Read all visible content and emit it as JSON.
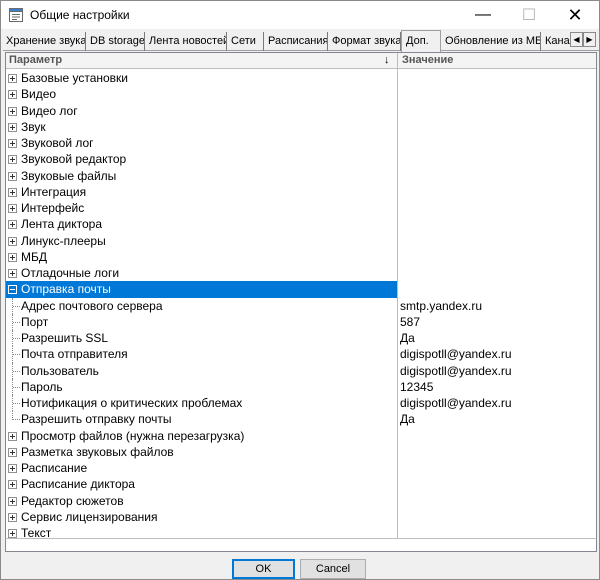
{
  "window": {
    "title": "Общие настройки",
    "icon": "settings-window-icon",
    "minimize_glyph": "—",
    "maximize_glyph": "☐",
    "close_glyph": "✕"
  },
  "tabs": [
    {
      "label": "Хранение звука",
      "active": false
    },
    {
      "label": "DB storage",
      "active": false
    },
    {
      "label": "Лента новостей",
      "active": false
    },
    {
      "label": "Сети",
      "active": false
    },
    {
      "label": "Расписания",
      "active": false
    },
    {
      "label": "Формат звука",
      "active": false
    },
    {
      "label": "Доп.",
      "active": true
    },
    {
      "label": "Обновление из МБД",
      "active": false
    },
    {
      "label": "Кана",
      "active": false
    }
  ],
  "tab_scroll": {
    "left": "◀",
    "right": "▶"
  },
  "grid": {
    "col_param": "Параметр",
    "col_value": "Значение",
    "sort_glyph": "↓"
  },
  "rows": [
    {
      "name": "Базовые установки",
      "value": "",
      "type": "group",
      "expanded": false
    },
    {
      "name": "Видео",
      "value": "",
      "type": "group",
      "expanded": false
    },
    {
      "name": "Видео лог",
      "value": "",
      "type": "group",
      "expanded": false
    },
    {
      "name": "Звук",
      "value": "",
      "type": "group",
      "expanded": false
    },
    {
      "name": "Звуковой лог",
      "value": "",
      "type": "group",
      "expanded": false
    },
    {
      "name": "Звуковой редактор",
      "value": "",
      "type": "group",
      "expanded": false
    },
    {
      "name": "Звуковые файлы",
      "value": "",
      "type": "group",
      "expanded": false
    },
    {
      "name": "Интеграция",
      "value": "",
      "type": "group",
      "expanded": false
    },
    {
      "name": "Интерфейс",
      "value": "",
      "type": "group",
      "expanded": false
    },
    {
      "name": "Лента диктора",
      "value": "",
      "type": "group",
      "expanded": false
    },
    {
      "name": "Линукс-плееры",
      "value": "",
      "type": "group",
      "expanded": false
    },
    {
      "name": "МБД",
      "value": "",
      "type": "group",
      "expanded": false
    },
    {
      "name": "Отладочные логи",
      "value": "",
      "type": "group",
      "expanded": false
    },
    {
      "name": "Отправка почты",
      "value": "",
      "type": "group",
      "expanded": true,
      "selected": true
    },
    {
      "name": "Адрес почтового сервера",
      "value": "smtp.yandex.ru",
      "type": "child"
    },
    {
      "name": "Порт",
      "value": "587",
      "type": "child"
    },
    {
      "name": "Разрешить SSL",
      "value": "Да",
      "type": "child"
    },
    {
      "name": "Почта отправителя",
      "value": "digispotll@yandex.ru",
      "type": "child"
    },
    {
      "name": "Пользователь",
      "value": "digispotll@yandex.ru",
      "type": "child"
    },
    {
      "name": "Пароль",
      "value": "12345",
      "type": "child"
    },
    {
      "name": "Нотификация о критических проблемах",
      "value": "digispotll@yandex.ru",
      "type": "child"
    },
    {
      "name": "Разрешить отправку почты",
      "value": "Да",
      "type": "child",
      "last": true
    },
    {
      "name": "Просмотр файлов (нужна перезагрузка)",
      "value": "",
      "type": "group",
      "expanded": false
    },
    {
      "name": "Разметка звуковых файлов",
      "value": "",
      "type": "group",
      "expanded": false
    },
    {
      "name": "Расписание",
      "value": "",
      "type": "group",
      "expanded": false
    },
    {
      "name": "Расписание диктора",
      "value": "",
      "type": "group",
      "expanded": false
    },
    {
      "name": "Редактор сюжетов",
      "value": "",
      "type": "group",
      "expanded": false
    },
    {
      "name": "Сервис лицензирования",
      "value": "",
      "type": "group",
      "expanded": false
    },
    {
      "name": "Текст",
      "value": "",
      "type": "group",
      "expanded": false
    }
  ],
  "buttons": {
    "ok": "OK",
    "cancel": "Cancel"
  },
  "colors": {
    "selection": "#0078d7",
    "window_bg": "#f0f0f0"
  }
}
